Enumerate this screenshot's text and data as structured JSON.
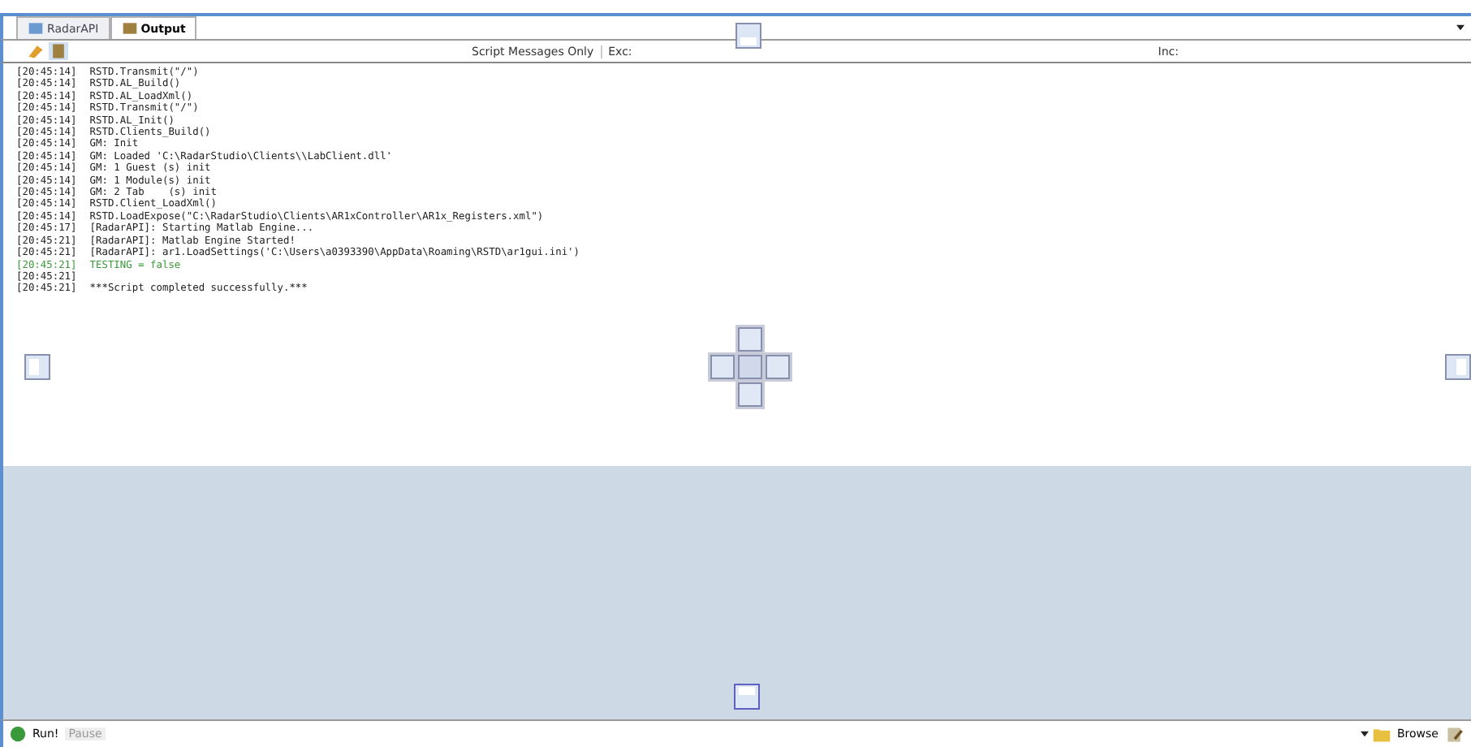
{
  "tabs": [
    {
      "label": "RadarAPI",
      "selected": false
    },
    {
      "label": "Output",
      "selected": true
    }
  ],
  "toolbar": {
    "filter_label": "Script Messages Only",
    "exclude_label": "Exc:",
    "include_label": "Inc:"
  },
  "log": [
    {
      "time": "[20:45:14]",
      "message": "RSTD.Transmit(\"/\")",
      "kind": "normal"
    },
    {
      "time": "[20:45:14]",
      "message": "RSTD.AL_Build()",
      "kind": "normal"
    },
    {
      "time": "[20:45:14]",
      "message": "RSTD.AL_LoadXml()",
      "kind": "normal"
    },
    {
      "time": "[20:45:14]",
      "message": "RSTD.Transmit(\"/\")",
      "kind": "normal"
    },
    {
      "time": "[20:45:14]",
      "message": "RSTD.AL_Init()",
      "kind": "normal"
    },
    {
      "time": "[20:45:14]",
      "message": "RSTD.Clients_Build()",
      "kind": "normal"
    },
    {
      "time": "[20:45:14]",
      "message": "GM: Init",
      "kind": "normal"
    },
    {
      "time": "[20:45:14]",
      "message": "GM: Loaded 'C:\\RadarStudio\\Clients\\\\LabClient.dll'",
      "kind": "normal"
    },
    {
      "time": "[20:45:14]",
      "message": "GM: 1 Guest (s) init",
      "kind": "normal"
    },
    {
      "time": "[20:45:14]",
      "message": "GM: 1 Module(s) init",
      "kind": "normal"
    },
    {
      "time": "[20:45:14]",
      "message": "GM: 2 Tab    (s) init",
      "kind": "normal"
    },
    {
      "time": "[20:45:14]",
      "message": "RSTD.Client_LoadXml()",
      "kind": "normal"
    },
    {
      "time": "[20:45:14]",
      "message": "RSTD.LoadExpose(\"C:\\RadarStudio\\Clients\\AR1xController\\AR1x_Registers.xml\")",
      "kind": "normal"
    },
    {
      "time": "[20:45:17]",
      "message": "[RadarAPI]: Starting Matlab Engine...",
      "kind": "normal"
    },
    {
      "time": "[20:45:21]",
      "message": "[RadarAPI]: Matlab Engine Started!",
      "kind": "normal"
    },
    {
      "time": "[20:45:21]",
      "message": "[RadarAPI]: ar1.LoadSettings('C:\\Users\\a0393390\\AppData\\Roaming\\RSTD\\ar1gui.ini')",
      "kind": "normal"
    },
    {
      "time": "[20:45:21]",
      "message": "TESTING = false",
      "kind": "green"
    },
    {
      "time": "[20:45:21]",
      "kind": "normal"
    },
    {
      "time": "[20:45:21]",
      "message": "***Script completed successfully.***",
      "kind": "normal"
    }
  ],
  "status_bar": {
    "run_label": "Run!",
    "pause": {
      "label": "Pause",
      "disabled": true
    },
    "browse_label": "Browse"
  }
}
